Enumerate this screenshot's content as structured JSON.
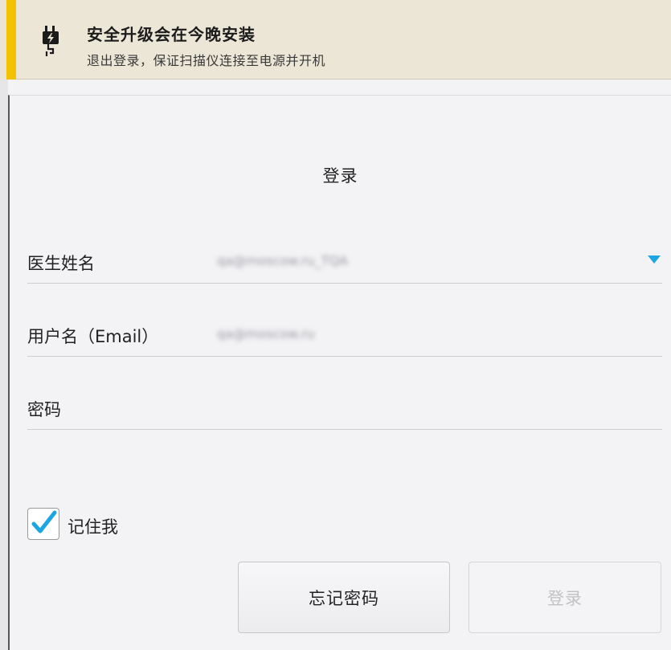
{
  "banner": {
    "icon": "plug-icon",
    "accent_color": "#f2c200",
    "title": "安全升级会在今晚安装",
    "subtitle": "退出登录，保证扫描仪连接至电源并开机"
  },
  "login": {
    "title": "登录",
    "fields": [
      {
        "label": "医生姓名",
        "value": "qa@moscow.ru_TQA",
        "type": "dropdown"
      },
      {
        "label": "用户名（Email）",
        "value": "qa@moscow.ru",
        "type": "text"
      },
      {
        "label": "密码",
        "value": "",
        "type": "password"
      }
    ],
    "remember_me": {
      "label": "记住我",
      "checked": true
    },
    "buttons": {
      "forgot_password": "忘记密码",
      "login": "登录"
    },
    "colors": {
      "accent": "#1aa6e3",
      "disabled_text": "#c2c2c6"
    }
  }
}
